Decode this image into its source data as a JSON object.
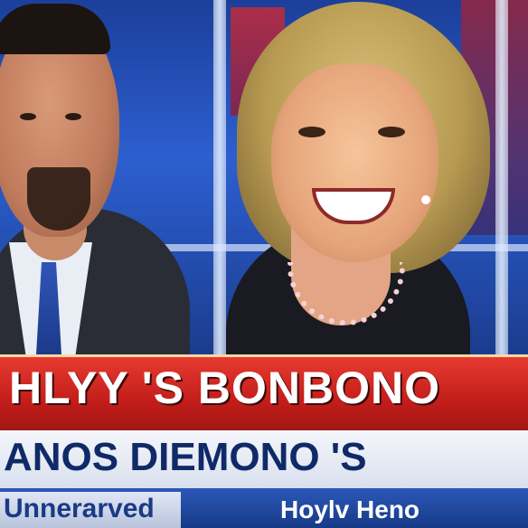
{
  "lower_third": {
    "headline": "HLYY 'S BONBONO",
    "subheadline": "ANOS DIEMONO 'S",
    "ticker_label": "Unnerarved",
    "ticker_text": "Hoylv Heno"
  },
  "colors": {
    "headline_bar": "#c21d1a",
    "subheadline_bar": "#e9edf6",
    "ticker_bar": "#1f4aa0",
    "studio_background": "#2d5fd0"
  }
}
